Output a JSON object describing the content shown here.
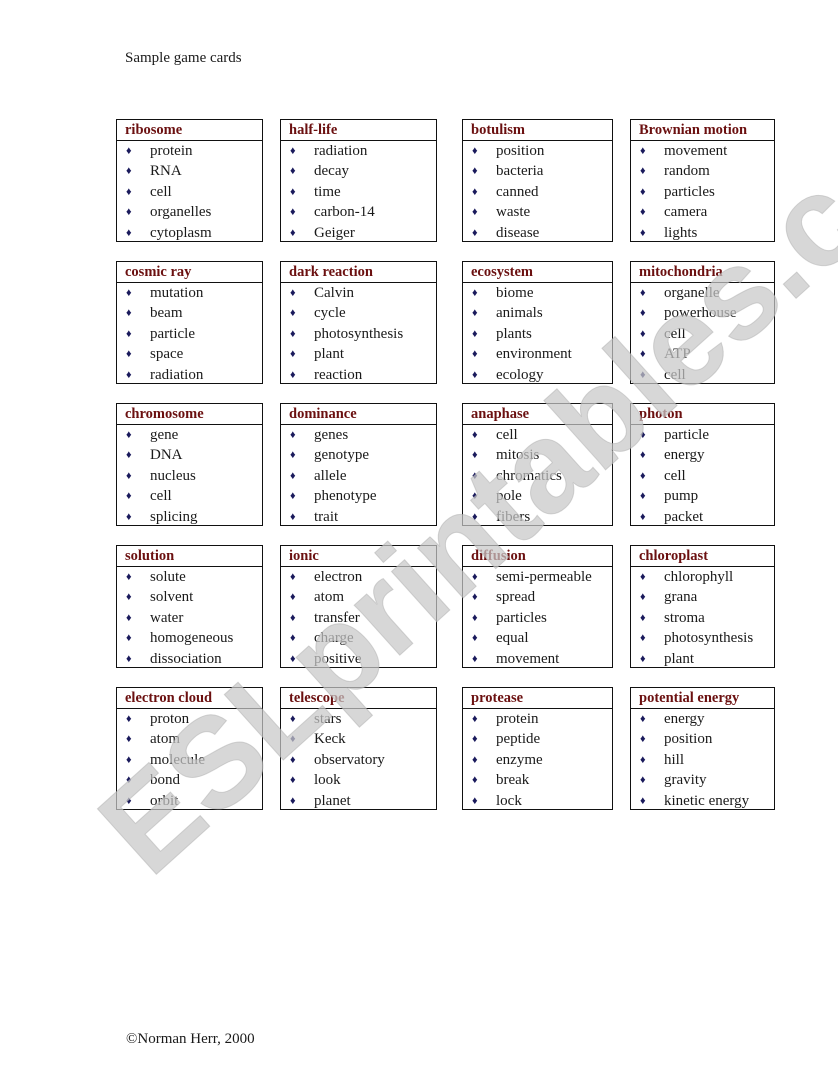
{
  "page": {
    "title": "Sample game cards",
    "footer": "©Norman Herr, 2000",
    "watermark": "ESLprintables.com",
    "bullet_glyph": "♦",
    "colors": {
      "title": "#6b1010",
      "bullet": "#1a1a5c",
      "text": "#1a1a1a",
      "border": "#111111",
      "watermark": "#c8c8c8"
    }
  },
  "cards": [
    {
      "title": "ribosome",
      "words": [
        "protein",
        "RNA",
        "cell",
        "organelles",
        "cytoplasm"
      ]
    },
    {
      "title": "half-life",
      "words": [
        "radiation",
        "decay",
        "time",
        "carbon-14",
        "Geiger"
      ]
    },
    {
      "title": "botulism",
      "words": [
        "position",
        "bacteria",
        "canned",
        "waste",
        "disease"
      ]
    },
    {
      "title": "Brownian motion",
      "words": [
        "movement",
        "random",
        "particles",
        "camera",
        "lights"
      ]
    },
    {
      "title": "cosmic ray",
      "words": [
        "mutation",
        "beam",
        "particle",
        "space",
        "radiation"
      ]
    },
    {
      "title": "dark reaction",
      "words": [
        "Calvin",
        "cycle",
        "photosynthesis",
        "plant",
        "reaction"
      ]
    },
    {
      "title": "ecosystem",
      "words": [
        "biome",
        "animals",
        "plants",
        "environment",
        "ecology"
      ]
    },
    {
      "title": "mitochondria",
      "words": [
        "organelle",
        "powerhouse",
        "cell",
        "ATP",
        "cell"
      ]
    },
    {
      "title": "chromosome",
      "words": [
        "gene",
        "DNA",
        "nucleus",
        "cell",
        "splicing"
      ]
    },
    {
      "title": "dominance",
      "words": [
        "genes",
        "genotype",
        "allele",
        "phenotype",
        "trait"
      ]
    },
    {
      "title": "anaphase",
      "words": [
        "cell",
        "mitosis",
        "chromatics",
        "pole",
        "fibers"
      ]
    },
    {
      "title": "photon",
      "words": [
        "particle",
        "energy",
        "cell",
        "pump",
        "packet"
      ]
    },
    {
      "title": "solution",
      "words": [
        "solute",
        "solvent",
        "water",
        "homogeneous",
        "dissociation"
      ]
    },
    {
      "title": "ionic",
      "words": [
        "electron",
        "atom",
        "transfer",
        "charge",
        "positive"
      ]
    },
    {
      "title": "diffusion",
      "words": [
        "semi-permeable",
        "spread",
        "particles",
        "equal",
        "movement"
      ]
    },
    {
      "title": "chloroplast",
      "words": [
        "chlorophyll",
        "grana",
        "stroma",
        "photosynthesis",
        "plant"
      ]
    },
    {
      "title": "electron cloud",
      "words": [
        "proton",
        "atom",
        "molecule",
        "bond",
        "orbit"
      ]
    },
    {
      "title": "telescope",
      "words": [
        "stars",
        "Keck",
        "observatory",
        "look",
        "planet"
      ]
    },
    {
      "title": "protease",
      "words": [
        "protein",
        "peptide",
        "enzyme",
        "break",
        "lock"
      ]
    },
    {
      "title": "potential energy",
      "words": [
        "energy",
        "position",
        "hill",
        "gravity",
        "kinetic energy"
      ]
    }
  ]
}
